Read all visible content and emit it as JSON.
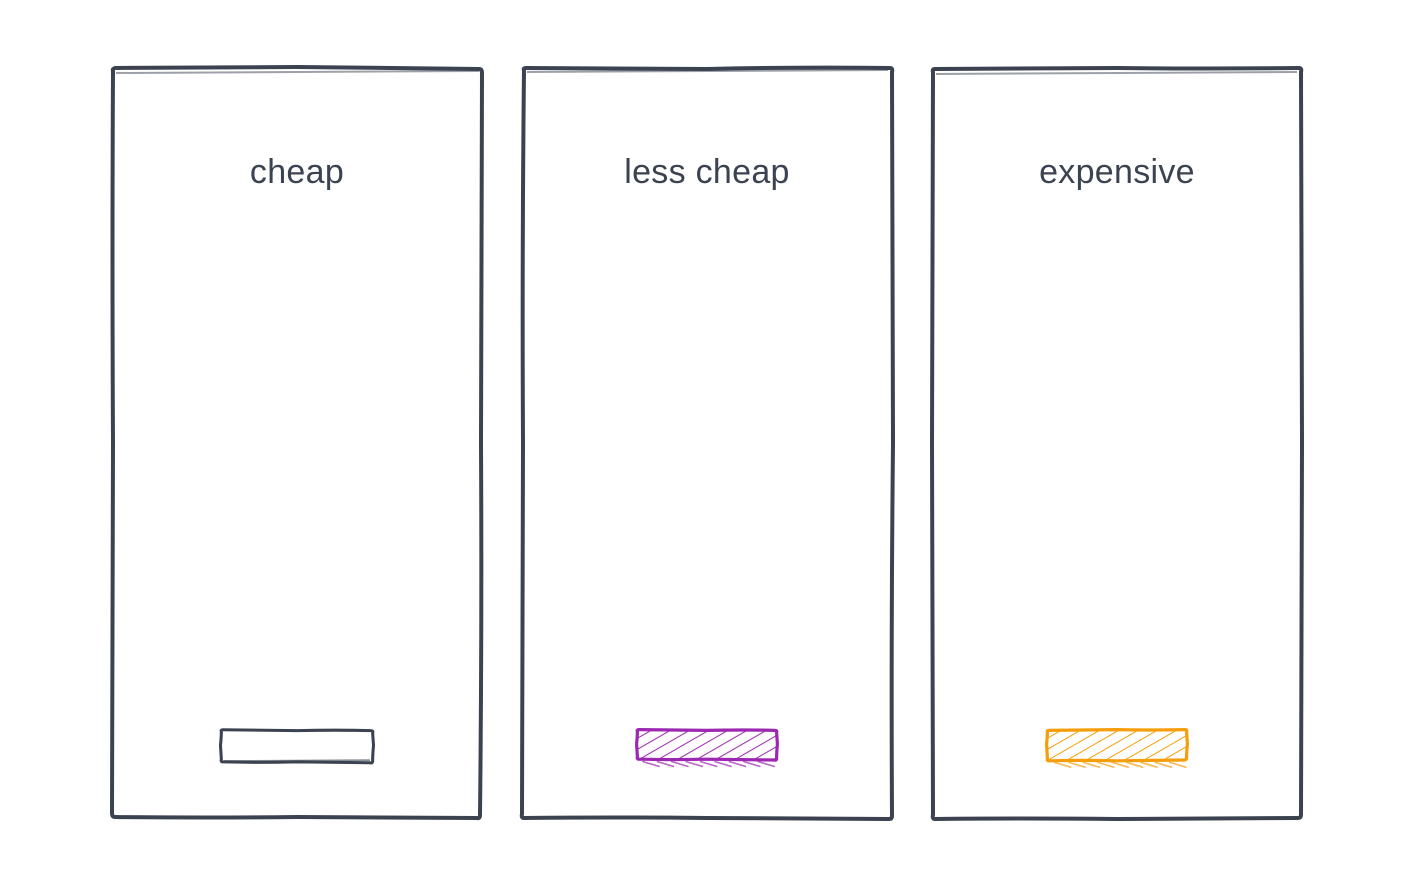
{
  "cards": [
    {
      "title": "cheap",
      "ad_fill": "none",
      "ad_stroke": "#3c4350"
    },
    {
      "title": "less cheap",
      "ad_fill": "hatch-purple",
      "ad_stroke": "#9c27b0"
    },
    {
      "title": "expensive",
      "ad_fill": "hatch-orange",
      "ad_stroke": "#f59e0b"
    }
  ],
  "colors": {
    "border": "#3c4350",
    "text": "#3c4350",
    "purple": "#9c27b0",
    "orange": "#f59e0b"
  }
}
